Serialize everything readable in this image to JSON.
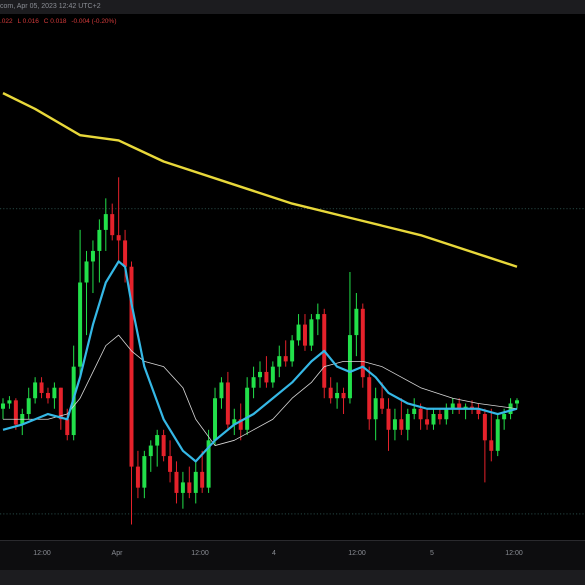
{
  "header": {
    "source_fragment": "com, Apr 05, 2023 12:42 UTC+2"
  },
  "ohlc": {
    "open_fragment": ".022",
    "low": "L 0.016",
    "close": "C 0.018",
    "change": "-0.004 (-0.20%)"
  },
  "chart_data": {
    "type": "candlestick",
    "x_ticks": [
      "12:00",
      "Apr",
      "12:00",
      "4",
      "12:00",
      "5",
      "12:00"
    ],
    "colors": {
      "up": "#22e04a",
      "down": "#e5222b",
      "ma_long": "#e8d83a",
      "ma_fast": "#35b8e6",
      "ma_slow": "#d8d8d8",
      "background": "#000000"
    },
    "ohlc_candles": [
      [
        0.0,
        0.1,
        -0.1,
        0.05
      ],
      [
        0.05,
        0.12,
        0.0,
        0.08
      ],
      [
        0.08,
        0.1,
        -0.2,
        -0.15
      ],
      [
        -0.15,
        0.0,
        -0.25,
        -0.05
      ],
      [
        -0.05,
        0.2,
        -0.1,
        0.1
      ],
      [
        0.1,
        0.3,
        0.05,
        0.25
      ],
      [
        0.25,
        0.3,
        0.1,
        0.15
      ],
      [
        0.15,
        0.2,
        0.05,
        0.1
      ],
      [
        0.1,
        0.25,
        0.0,
        0.2
      ],
      [
        0.2,
        0.2,
        -0.2,
        -0.1
      ],
      [
        -0.1,
        0.0,
        -0.3,
        -0.25
      ],
      [
        -0.25,
        0.6,
        -0.3,
        0.4
      ],
      [
        0.4,
        1.7,
        0.3,
        1.2
      ],
      [
        1.2,
        1.5,
        0.7,
        1.4
      ],
      [
        1.4,
        1.6,
        1.1,
        1.5
      ],
      [
        1.5,
        1.8,
        1.2,
        1.7
      ],
      [
        1.7,
        2.0,
        1.5,
        1.85
      ],
      [
        1.85,
        1.95,
        1.6,
        1.65
      ],
      [
        1.65,
        2.2,
        1.4,
        1.6
      ],
      [
        1.6,
        1.7,
        1.2,
        1.35
      ],
      [
        1.35,
        1.4,
        -1.1,
        -0.55
      ],
      [
        -0.55,
        -0.4,
        -0.85,
        -0.75
      ],
      [
        -0.75,
        -0.4,
        -0.85,
        -0.45
      ],
      [
        -0.45,
        -0.3,
        -0.6,
        -0.35
      ],
      [
        -0.35,
        -0.2,
        -0.55,
        -0.25
      ],
      [
        -0.25,
        -0.2,
        -0.5,
        -0.45
      ],
      [
        -0.45,
        -0.3,
        -0.7,
        -0.6
      ],
      [
        -0.6,
        -0.5,
        -0.9,
        -0.8
      ],
      [
        -0.8,
        -0.6,
        -0.95,
        -0.7
      ],
      [
        -0.7,
        -0.55,
        -0.85,
        -0.8
      ],
      [
        -0.8,
        -0.5,
        -0.9,
        -0.6
      ],
      [
        -0.6,
        -0.4,
        -0.8,
        -0.75
      ],
      [
        -0.75,
        -0.2,
        -0.8,
        -0.3
      ],
      [
        -0.3,
        0.2,
        -0.35,
        0.1
      ],
      [
        0.1,
        0.3,
        0.0,
        0.25
      ],
      [
        0.25,
        0.35,
        -0.2,
        -0.15
      ],
      [
        -0.15,
        0.0,
        -0.25,
        -0.1
      ],
      [
        -0.1,
        0.05,
        -0.3,
        -0.2
      ],
      [
        -0.2,
        0.3,
        -0.25,
        0.2
      ],
      [
        0.2,
        0.4,
        0.1,
        0.3
      ],
      [
        0.3,
        0.45,
        0.2,
        0.35
      ],
      [
        0.35,
        0.5,
        0.2,
        0.25
      ],
      [
        0.25,
        0.45,
        0.2,
        0.4
      ],
      [
        0.4,
        0.6,
        0.3,
        0.5
      ],
      [
        0.5,
        0.65,
        0.4,
        0.45
      ],
      [
        0.45,
        0.7,
        0.4,
        0.65
      ],
      [
        0.65,
        0.9,
        0.6,
        0.8
      ],
      [
        0.8,
        0.9,
        0.55,
        0.6
      ],
      [
        0.6,
        0.9,
        0.55,
        0.85
      ],
      [
        0.85,
        1.0,
        0.7,
        0.9
      ],
      [
        0.9,
        0.95,
        0.1,
        0.2
      ],
      [
        0.2,
        0.3,
        0.05,
        0.1
      ],
      [
        0.1,
        0.25,
        0.0,
        0.15
      ],
      [
        0.15,
        0.2,
        -0.05,
        0.1
      ],
      [
        0.1,
        1.3,
        0.05,
        0.7
      ],
      [
        0.7,
        1.1,
        0.5,
        0.95
      ],
      [
        0.95,
        1.0,
        0.2,
        0.3
      ],
      [
        0.3,
        0.4,
        -0.2,
        -0.1
      ],
      [
        -0.1,
        0.2,
        -0.3,
        0.1
      ],
      [
        0.1,
        0.25,
        -0.05,
        0.0
      ],
      [
        0.0,
        0.1,
        -0.4,
        -0.2
      ],
      [
        -0.2,
        0.0,
        -0.3,
        -0.1
      ],
      [
        -0.1,
        0.1,
        -0.25,
        -0.2
      ],
      [
        -0.2,
        0.0,
        -0.3,
        -0.05
      ],
      [
        -0.05,
        0.1,
        -0.1,
        0.0
      ],
      [
        0.0,
        0.05,
        -0.2,
        -0.1
      ],
      [
        -0.1,
        0.0,
        -0.2,
        -0.15
      ],
      [
        -0.15,
        0.0,
        -0.2,
        -0.05
      ],
      [
        -0.05,
        0.0,
        -0.15,
        -0.1
      ],
      [
        -0.1,
        0.05,
        -0.15,
        0.0
      ],
      [
        0.0,
        0.1,
        -0.05,
        0.05
      ],
      [
        0.05,
        0.1,
        -0.05,
        0.0
      ],
      [
        0.0,
        0.05,
        -0.1,
        0.02
      ],
      [
        0.02,
        0.08,
        -0.05,
        0.0
      ],
      [
        0.0,
        0.05,
        -0.1,
        -0.05
      ],
      [
        -0.05,
        0.0,
        -0.7,
        -0.3
      ],
      [
        -0.3,
        0.0,
        -0.5,
        -0.4
      ],
      [
        -0.4,
        -0.05,
        -0.45,
        -0.1
      ],
      [
        -0.1,
        0.0,
        -0.2,
        -0.05
      ],
      [
        -0.05,
        0.1,
        -0.1,
        0.05
      ],
      [
        0.05,
        0.1,
        0.0,
        0.08
      ]
    ],
    "ma_long": [
      [
        0,
        3.0
      ],
      [
        5,
        2.85
      ],
      [
        12,
        2.6
      ],
      [
        18,
        2.55
      ],
      [
        25,
        2.35
      ],
      [
        35,
        2.15
      ],
      [
        45,
        1.95
      ],
      [
        55,
        1.8
      ],
      [
        65,
        1.65
      ],
      [
        75,
        1.45
      ],
      [
        80,
        1.35
      ]
    ],
    "ma_fast": [
      [
        0,
        -0.2
      ],
      [
        3,
        -0.15
      ],
      [
        7,
        -0.05
      ],
      [
        10,
        -0.1
      ],
      [
        12,
        0.3
      ],
      [
        14,
        0.8
      ],
      [
        16,
        1.2
      ],
      [
        18,
        1.4
      ],
      [
        19,
        1.35
      ],
      [
        20,
        1.0
      ],
      [
        22,
        0.4
      ],
      [
        25,
        -0.1
      ],
      [
        28,
        -0.4
      ],
      [
        30,
        -0.5
      ],
      [
        33,
        -0.3
      ],
      [
        36,
        -0.15
      ],
      [
        39,
        -0.05
      ],
      [
        42,
        0.1
      ],
      [
        45,
        0.25
      ],
      [
        48,
        0.45
      ],
      [
        50,
        0.55
      ],
      [
        52,
        0.4
      ],
      [
        54,
        0.35
      ],
      [
        56,
        0.4
      ],
      [
        58,
        0.3
      ],
      [
        60,
        0.15
      ],
      [
        63,
        0.05
      ],
      [
        66,
        0.0
      ],
      [
        70,
        0.0
      ],
      [
        74,
        0.0
      ],
      [
        77,
        -0.05
      ],
      [
        80,
        0.0
      ]
    ],
    "ma_slow": [
      [
        0,
        -0.1
      ],
      [
        3,
        -0.1
      ],
      [
        7,
        -0.1
      ],
      [
        10,
        -0.05
      ],
      [
        12,
        0.1
      ],
      [
        14,
        0.35
      ],
      [
        16,
        0.6
      ],
      [
        18,
        0.7
      ],
      [
        20,
        0.55
      ],
      [
        22,
        0.45
      ],
      [
        25,
        0.4
      ],
      [
        28,
        0.2
      ],
      [
        30,
        -0.1
      ],
      [
        33,
        -0.35
      ],
      [
        36,
        -0.3
      ],
      [
        39,
        -0.2
      ],
      [
        42,
        -0.1
      ],
      [
        45,
        0.1
      ],
      [
        48,
        0.25
      ],
      [
        50,
        0.4
      ],
      [
        53,
        0.45
      ],
      [
        56,
        0.45
      ],
      [
        59,
        0.4
      ],
      [
        62,
        0.3
      ],
      [
        65,
        0.2
      ],
      [
        70,
        0.1
      ],
      [
        74,
        0.05
      ],
      [
        80,
        0.0
      ]
    ],
    "y_range": [
      -1.2,
      3.6
    ],
    "grid": false
  }
}
